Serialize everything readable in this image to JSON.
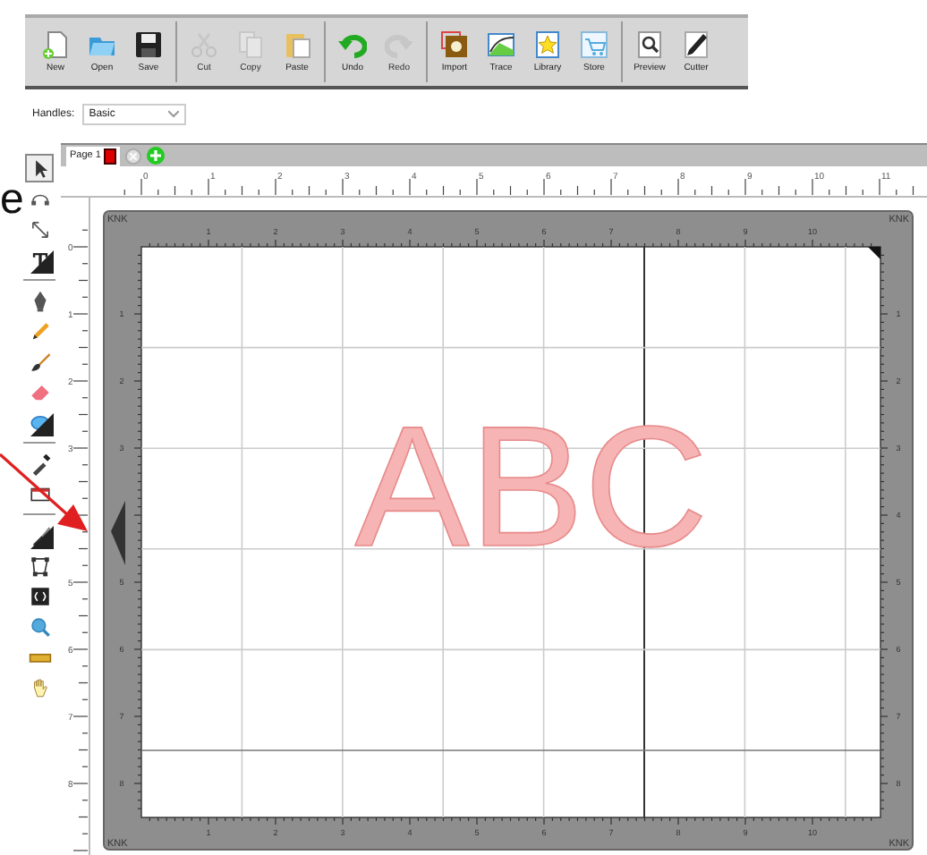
{
  "toolbar": {
    "groups": [
      [
        {
          "label": "New",
          "disabled": false
        },
        {
          "label": "Open",
          "disabled": false
        },
        {
          "label": "Save",
          "disabled": false
        }
      ],
      [
        {
          "label": "Cut",
          "disabled": true
        },
        {
          "label": "Copy",
          "disabled": true
        },
        {
          "label": "Paste",
          "disabled": false
        }
      ],
      [
        {
          "label": "Undo",
          "disabled": false
        },
        {
          "label": "Redo",
          "disabled": true
        }
      ],
      [
        {
          "label": "Import",
          "disabled": false
        },
        {
          "label": "Trace",
          "disabled": false
        },
        {
          "label": "Library",
          "disabled": false
        },
        {
          "label": "Store",
          "disabled": false
        }
      ],
      [
        {
          "label": "Preview",
          "disabled": false
        },
        {
          "label": "Cutter",
          "disabled": false
        }
      ]
    ]
  },
  "handles": {
    "label": "Handles:",
    "value": "Basic"
  },
  "tools": [
    {
      "kind": "tool",
      "selected": true,
      "has_menu": false
    },
    {
      "kind": "tool",
      "selected": false,
      "has_menu": false
    },
    {
      "kind": "tool",
      "selected": false,
      "has_menu": false
    },
    {
      "kind": "tool",
      "selected": false,
      "has_menu": true
    },
    {
      "kind": "separator"
    },
    {
      "kind": "tool",
      "selected": false,
      "has_menu": false
    },
    {
      "kind": "tool",
      "selected": false,
      "has_menu": false
    },
    {
      "kind": "tool",
      "selected": false,
      "has_menu": false
    },
    {
      "kind": "tool",
      "selected": false,
      "has_menu": false
    },
    {
      "kind": "tool",
      "selected": false,
      "has_menu": true
    },
    {
      "kind": "separator"
    },
    {
      "kind": "tool",
      "selected": false,
      "has_menu": false
    },
    {
      "kind": "tool",
      "selected": false,
      "has_menu": false
    },
    {
      "kind": "separator"
    },
    {
      "kind": "tool",
      "selected": false,
      "has_menu": true
    },
    {
      "kind": "tool",
      "selected": false,
      "has_menu": false
    },
    {
      "kind": "tool",
      "selected": false,
      "has_menu": false
    },
    {
      "kind": "tool",
      "selected": false,
      "has_menu": false
    },
    {
      "kind": "tool",
      "selected": false,
      "has_menu": false
    },
    {
      "kind": "tool",
      "selected": false,
      "has_menu": false
    }
  ],
  "page_tabs": [
    {
      "label": "Page 1",
      "selected": true
    }
  ],
  "rulers": {
    "horizontal": [
      "0",
      "1",
      "2",
      "3",
      "4",
      "5",
      "6",
      "7",
      "8",
      "9",
      "10",
      "11"
    ],
    "vertical_upper": [
      "0",
      "1",
      "2",
      "3"
    ],
    "vertical_lower": [
      "5",
      "6",
      "7",
      "8"
    ]
  },
  "mat": {
    "corner_labels": [
      "KNK",
      "KNK",
      "KNK",
      "KNK"
    ],
    "top_numbers": [
      "1",
      "2",
      "3",
      "4",
      "5",
      "6",
      "7",
      "8",
      "9",
      "10"
    ],
    "bottom_numbers": [
      "1",
      "2",
      "3",
      "4",
      "5",
      "6",
      "7",
      "8",
      "9",
      "10"
    ],
    "left_upper": [
      "1",
      "2",
      "3"
    ],
    "left_lower": [
      "5",
      "6",
      "7",
      "8"
    ],
    "right_numbers": [
      "1",
      "2",
      "3",
      "4",
      "5",
      "6",
      "7",
      "8"
    ]
  },
  "design_text": {
    "text": "ABC"
  },
  "annotation": {
    "text": "e"
  }
}
